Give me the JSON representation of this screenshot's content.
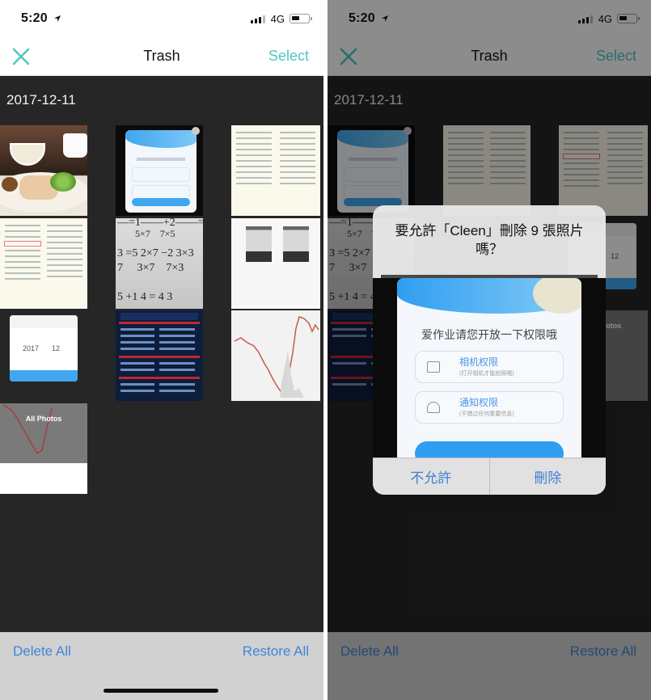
{
  "status_bar": {
    "time": "5:20",
    "network": "4G"
  },
  "nav": {
    "title": "Trash",
    "select_label": "Select",
    "close_icon": "close-x-icon"
  },
  "section": {
    "date": "2017-12-11"
  },
  "thumbnails": [
    {
      "kind": "food-photo"
    },
    {
      "kind": "permission-dialog-screenshot"
    },
    {
      "kind": "math-worksheet"
    },
    {
      "kind": "math-worksheet-highlighted"
    },
    {
      "kind": "fractions-photo"
    },
    {
      "kind": "album-screenshot"
    },
    {
      "kind": "month-picker-screenshot",
      "picker_year": "2017",
      "picker_month": "12"
    },
    {
      "kind": "news-infographic"
    },
    {
      "kind": "stock-chart"
    },
    {
      "kind": "all-photos-screenshot",
      "label": "All Photos"
    }
  ],
  "bottom_bar": {
    "delete_all_label": "Delete All",
    "restore_all_label": "Restore All"
  },
  "alert": {
    "title": "要允許「Cleen」刪除 9 張照片嗎？",
    "preview": {
      "headline": "爱作业请您开放一下权限哦",
      "permissions": [
        {
          "title": "相机权限",
          "subtitle": "(打开相机才能拍照哦)",
          "icon": "camera-icon"
        },
        {
          "title": "通知权限",
          "subtitle": "(不错过任何重要信息)",
          "icon": "bell-icon"
        }
      ]
    },
    "deny_label": "不允許",
    "confirm_label": "刪除"
  },
  "colors": {
    "accent_teal": "#4ec7bf",
    "link_blue": "#3e87d6",
    "content_bg": "#262626",
    "bottom_bar_bg": "#d1d1d1"
  }
}
